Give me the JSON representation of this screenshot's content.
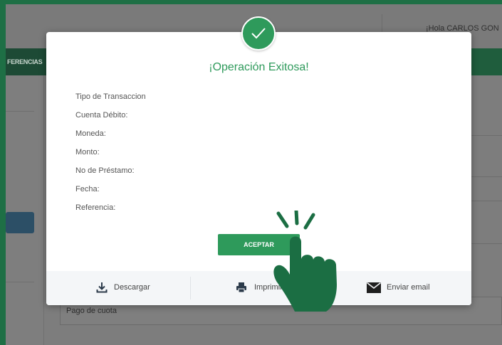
{
  "app": {
    "greeting": "¡Hola CARLOS GON",
    "nav_item": "FERENCIAS",
    "field_value": "Pago de cuota"
  },
  "modal": {
    "title": "¡Operación Exitosa!",
    "fields": [
      {
        "label": "Tipo de Transaccion"
      },
      {
        "label": "Cuenta Débito:"
      },
      {
        "label": "Moneda:"
      },
      {
        "label": "Monto:"
      },
      {
        "label": "No de Préstamo:"
      },
      {
        "label": "Fecha:"
      },
      {
        "label": "Referencia:"
      }
    ],
    "accept_label": "ACEPTAR",
    "footer": {
      "download_label": "Descargar",
      "print_label": "Imprimir",
      "email_label": "Enviar email"
    }
  },
  "colors": {
    "accent": "#2e9a5b",
    "frame": "#1e6f45",
    "overlay": "#7c7c7c",
    "hand": "#1b6e43"
  },
  "icons": [
    "check-icon",
    "download-icon",
    "printer-icon",
    "envelope-icon",
    "pointing-hand-icon"
  ]
}
